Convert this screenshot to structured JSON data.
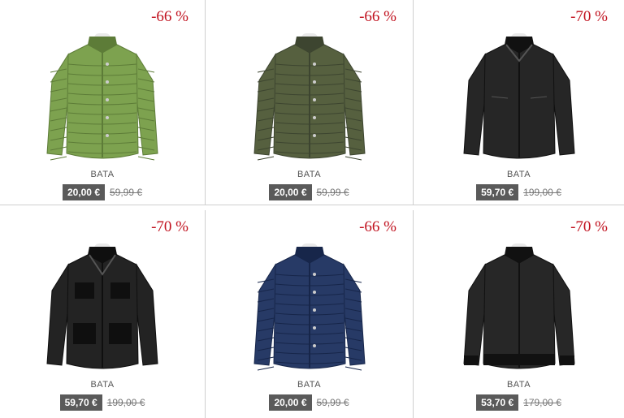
{
  "products": [
    {
      "discount": "-66 %",
      "brand": "BATA",
      "price": "20,00 €",
      "old_price": "59,99 €",
      "jacket_color": "#7da24f",
      "jacket_dark": "#5d7c38",
      "type": "puffer"
    },
    {
      "discount": "-66 %",
      "brand": "BATA",
      "price": "20,00 €",
      "old_price": "59,99 €",
      "jacket_color": "#56603f",
      "jacket_dark": "#3d4530",
      "type": "puffer"
    },
    {
      "discount": "-70 %",
      "brand": "BATA",
      "price": "59,70 €",
      "old_price": "199,00 €",
      "jacket_color": "#262626",
      "jacket_dark": "#111111",
      "type": "leather"
    },
    {
      "discount": "-70 %",
      "brand": "BATA",
      "price": "59,70 €",
      "old_price": "199,00 €",
      "jacket_color": "#232323",
      "jacket_dark": "#0f0f0f",
      "type": "field"
    },
    {
      "discount": "-66 %",
      "brand": "BATA",
      "price": "20,00 €",
      "old_price": "59,99 €",
      "jacket_color": "#273a66",
      "jacket_dark": "#17264a",
      "type": "puffer"
    },
    {
      "discount": "-70 %",
      "brand": "BATA",
      "price": "53,70 €",
      "old_price": "179,00 €",
      "jacket_color": "#272727",
      "jacket_dark": "#111111",
      "type": "bomber"
    }
  ]
}
